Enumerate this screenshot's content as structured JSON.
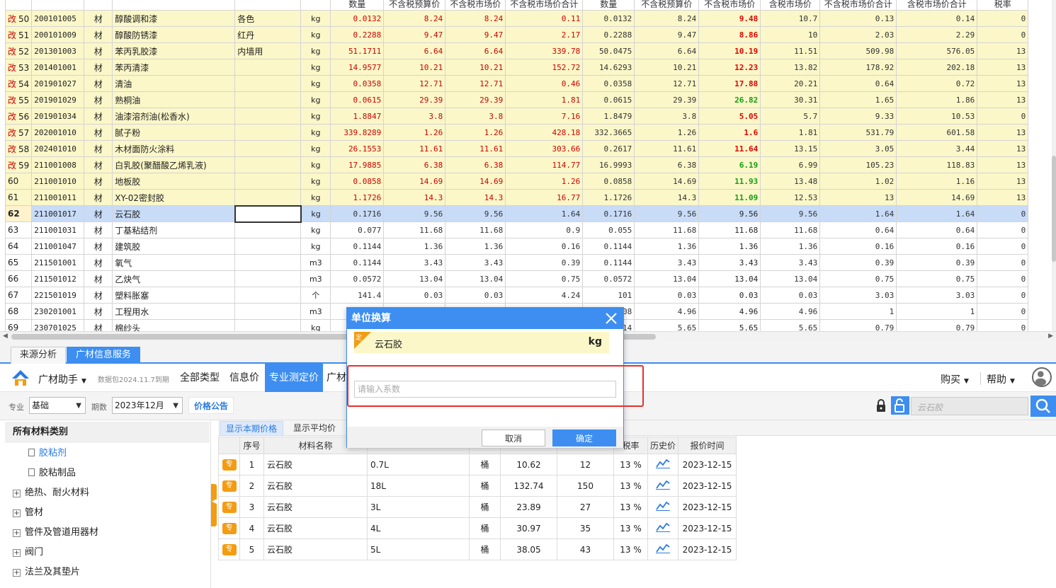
{
  "grid": {
    "headers": [
      "",
      "",
      "",
      "",
      "",
      "",
      "数量",
      "不含税预算价",
      "不含税市场价",
      "不含税市场价合计",
      "数量",
      "不含税预算价",
      "不含税市场价",
      "含税市场价",
      "不含税市场价合计",
      "含税市场价合计",
      "税率"
    ],
    "rows": [
      {
        "mark": "改",
        "no": "50",
        "code": "200101005",
        "type": "材",
        "name": "醇酸调和漆",
        "spec": "各色",
        "unit": "kg",
        "qty1": "0.0132",
        "bp": "8.24",
        "mp": "8.24",
        "mpt": "0.11",
        "qty2": "0.0132",
        "bp2": "8.24",
        "mp2": "9.48",
        "tp": "10.7",
        "mpt2": "0.13",
        "tpt": "0.14",
        "tax": "0",
        "style": "mod",
        "mp2c": "red"
      },
      {
        "mark": "改",
        "no": "51",
        "code": "200101009",
        "type": "材",
        "name": "醇酸防锈漆",
        "spec": "红丹",
        "unit": "kg",
        "qty1": "0.2288",
        "bp": "9.47",
        "mp": "9.47",
        "mpt": "2.17",
        "qty2": "0.2288",
        "bp2": "9.47",
        "mp2": "8.86",
        "tp": "10",
        "mpt2": "2.03",
        "tpt": "2.29",
        "tax": "0",
        "style": "mod",
        "mp2c": "red"
      },
      {
        "mark": "改",
        "no": "52",
        "code": "201301003",
        "type": "材",
        "name": "苯丙乳胶漆",
        "spec": "内墙用",
        "unit": "kg",
        "qty1": "51.1711",
        "bp": "6.64",
        "mp": "6.64",
        "mpt": "339.78",
        "qty2": "50.0475",
        "bp2": "6.64",
        "mp2": "10.19",
        "tp": "11.51",
        "mpt2": "509.98",
        "tpt": "576.05",
        "tax": "13",
        "style": "mod",
        "mp2c": "red"
      },
      {
        "mark": "改",
        "no": "53",
        "code": "201401001",
        "type": "材",
        "name": "苯丙清漆",
        "spec": "",
        "unit": "kg",
        "qty1": "14.9577",
        "bp": "10.21",
        "mp": "10.21",
        "mpt": "152.72",
        "qty2": "14.6293",
        "bp2": "10.21",
        "mp2": "12.23",
        "tp": "13.82",
        "mpt2": "178.92",
        "tpt": "202.18",
        "tax": "13",
        "style": "mod",
        "mp2c": "red"
      },
      {
        "mark": "改",
        "no": "54",
        "code": "201901027",
        "type": "材",
        "name": "清油",
        "spec": "",
        "unit": "kg",
        "qty1": "0.0358",
        "bp": "12.71",
        "mp": "12.71",
        "mpt": "0.46",
        "qty2": "0.0358",
        "bp2": "12.71",
        "mp2": "17.88",
        "tp": "20.21",
        "mpt2": "0.64",
        "tpt": "0.72",
        "tax": "13",
        "style": "mod",
        "mp2c": "red"
      },
      {
        "mark": "改",
        "no": "55",
        "code": "201901029",
        "type": "材",
        "name": "熟桐油",
        "spec": "",
        "unit": "kg",
        "qty1": "0.0615",
        "bp": "29.39",
        "mp": "29.39",
        "mpt": "1.81",
        "qty2": "0.0615",
        "bp2": "29.39",
        "mp2": "26.82",
        "tp": "30.31",
        "mpt2": "1.65",
        "tpt": "1.86",
        "tax": "13",
        "style": "mod",
        "mp2c": "green"
      },
      {
        "mark": "改",
        "no": "56",
        "code": "201901034",
        "type": "材",
        "name": "油漆溶剂油(松香水)",
        "spec": "",
        "unit": "kg",
        "qty1": "1.8847",
        "bp": "3.8",
        "mp": "3.8",
        "mpt": "7.16",
        "qty2": "1.8479",
        "bp2": "3.8",
        "mp2": "5.05",
        "tp": "5.7",
        "mpt2": "9.33",
        "tpt": "10.53",
        "tax": "0",
        "style": "mod",
        "mp2c": "red"
      },
      {
        "mark": "改",
        "no": "57",
        "code": "202001010",
        "type": "材",
        "name": "腻子粉",
        "spec": "",
        "unit": "kg",
        "qty1": "339.8289",
        "bp": "1.26",
        "mp": "1.26",
        "mpt": "428.18",
        "qty2": "332.3665",
        "bp2": "1.26",
        "mp2": "1.6",
        "tp": "1.81",
        "mpt2": "531.79",
        "tpt": "601.58",
        "tax": "13",
        "style": "mod",
        "mp2c": "red"
      },
      {
        "mark": "改",
        "no": "58",
        "code": "202401010",
        "type": "材",
        "name": "木材面防火涂料",
        "spec": "",
        "unit": "kg",
        "qty1": "26.1553",
        "bp": "11.61",
        "mp": "11.61",
        "mpt": "303.66",
        "qty2": "0.2617",
        "bp2": "11.61",
        "mp2": "11.64",
        "tp": "13.15",
        "mpt2": "3.05",
        "tpt": "3.44",
        "tax": "13",
        "style": "mod",
        "mp2c": "red"
      },
      {
        "mark": "改",
        "no": "59",
        "code": "211001008",
        "type": "材",
        "name": "白乳胶(聚醋酸乙烯乳液)",
        "spec": "",
        "unit": "kg",
        "qty1": "17.9885",
        "bp": "6.38",
        "mp": "6.38",
        "mpt": "114.77",
        "qty2": "16.9993",
        "bp2": "6.38",
        "mp2": "6.19",
        "tp": "6.99",
        "mpt2": "105.23",
        "tpt": "118.83",
        "tax": "13",
        "style": "mod",
        "mp2c": "green"
      },
      {
        "mark": "",
        "no": "60",
        "code": "211001010",
        "type": "材",
        "name": "地板胶",
        "spec": "",
        "unit": "kg",
        "qty1": "0.0858",
        "bp": "14.69",
        "mp": "14.69",
        "mpt": "1.26",
        "qty2": "0.0858",
        "bp2": "14.69",
        "mp2": "11.93",
        "tp": "13.48",
        "mpt2": "1.02",
        "tpt": "1.16",
        "tax": "13",
        "style": "mod",
        "mp2c": "green"
      },
      {
        "mark": "",
        "no": "61",
        "code": "211001011",
        "type": "材",
        "name": "XY-02密封胶",
        "spec": "",
        "unit": "kg",
        "qty1": "1.1726",
        "bp": "14.3",
        "mp": "14.3",
        "mpt": "16.77",
        "qty2": "1.1726",
        "bp2": "14.3",
        "mp2": "11.09",
        "tp": "12.53",
        "mpt2": "13",
        "tpt": "14.69",
        "tax": "13",
        "style": "mod",
        "mp2c": "green"
      },
      {
        "mark": "",
        "no": "62",
        "code": "211001017",
        "type": "材",
        "name": "云石胶",
        "spec": "",
        "unit": "kg",
        "qty1": "0.1716",
        "bp": "9.56",
        "mp": "9.56",
        "mpt": "1.64",
        "qty2": "0.1716",
        "bp2": "9.56",
        "mp2": "9.56",
        "tp": "9.56",
        "mpt2": "1.64",
        "tpt": "1.64",
        "tax": "0",
        "style": "sel",
        "mp2c": "plain"
      },
      {
        "mark": "",
        "no": "63",
        "code": "211001031",
        "type": "材",
        "name": "丁基粘结剂",
        "spec": "",
        "unit": "kg",
        "qty1": "0.077",
        "bp": "11.68",
        "mp": "11.68",
        "mpt": "0.9",
        "qty2": "0.055",
        "bp2": "11.68",
        "mp2": "11.68",
        "tp": "11.68",
        "mpt2": "0.64",
        "tpt": "0.64",
        "tax": "0",
        "style": "normal",
        "mp2c": "plain"
      },
      {
        "mark": "",
        "no": "64",
        "code": "211001047",
        "type": "材",
        "name": "建筑胶",
        "spec": "",
        "unit": "kg",
        "qty1": "0.1144",
        "bp": "1.36",
        "mp": "1.36",
        "mpt": "0.16",
        "qty2": "0.1144",
        "bp2": "1.36",
        "mp2": "1.36",
        "tp": "1.36",
        "mpt2": "0.16",
        "tpt": "0.16",
        "tax": "0",
        "style": "normal",
        "mp2c": "plain"
      },
      {
        "mark": "",
        "no": "65",
        "code": "211501001",
        "type": "材",
        "name": "氧气",
        "spec": "",
        "unit": "m3",
        "qty1": "0.1144",
        "bp": "3.43",
        "mp": "3.43",
        "mpt": "0.39",
        "qty2": "0.1144",
        "bp2": "3.43",
        "mp2": "3.43",
        "tp": "3.43",
        "mpt2": "0.39",
        "tpt": "0.39",
        "tax": "0",
        "style": "normal",
        "mp2c": "plain"
      },
      {
        "mark": "",
        "no": "66",
        "code": "211501012",
        "type": "材",
        "name": "乙炔气",
        "spec": "",
        "unit": "m3",
        "qty1": "0.0572",
        "bp": "13.04",
        "mp": "13.04",
        "mpt": "0.75",
        "qty2": "0.0572",
        "bp2": "13.04",
        "mp2": "13.04",
        "tp": "13.04",
        "mpt2": "0.75",
        "tpt": "0.75",
        "tax": "0",
        "style": "normal",
        "mp2c": "plain"
      },
      {
        "mark": "",
        "no": "67",
        "code": "221501019",
        "type": "材",
        "name": "塑料胀塞",
        "spec": "",
        "unit": "个",
        "qty1": "141.4",
        "bp": "0.03",
        "mp": "0.03",
        "mpt": "4.24",
        "qty2": "101",
        "bp2": "0.03",
        "mp2": "0.03",
        "tp": "0.03",
        "mpt2": "3.03",
        "tpt": "3.03",
        "tax": "0",
        "style": "normal",
        "mp2c": "plain"
      },
      {
        "mark": "",
        "no": "68",
        "code": "230201001",
        "type": "材",
        "name": "工程用水",
        "spec": "",
        "unit": "m3",
        "qty1": "",
        "bp": "",
        "mp": "",
        "mpt": "",
        "qty2": "2008",
        "bp2": "4.96",
        "mp2": "4.96",
        "tp": "4.96",
        "mpt2": "1",
        "tpt": "1",
        "tax": "0",
        "style": "normal",
        "mp2c": "plain"
      },
      {
        "mark": "",
        "no": "69",
        "code": "230701025",
        "type": "材",
        "name": "棉纱头",
        "spec": "",
        "unit": "kg",
        "qty1": "",
        "bp": "",
        "mp": "",
        "mpt": "",
        "qty2": "0.14",
        "bp2": "5.65",
        "mp2": "5.65",
        "tp": "5.65",
        "mpt2": "0.79",
        "tpt": "0.79",
        "tax": "0",
        "style": "normal",
        "mp2c": "plain"
      }
    ]
  },
  "tabs": {
    "source": "来源分析",
    "service": "广材信息服务"
  },
  "toolbar": {
    "brand": "广材助手",
    "data_pack": "数据包2024.11.7到期",
    "nav": [
      "全部类型",
      "信息价",
      "专业测定价",
      "广材"
    ],
    "buy": "购买",
    "help": "帮助"
  },
  "filter": {
    "major_label": "专业",
    "major_value": "基础",
    "period_label": "期数",
    "period_value": "2023年12月",
    "notice": "价格公告",
    "search_placeholder": "云石胶"
  },
  "left_panel": {
    "title": "所有材料类别",
    "items": [
      {
        "label": "胶粘剂",
        "kind": "leaf",
        "active": true
      },
      {
        "label": "胶粘制品",
        "kind": "leaf",
        "active": false
      },
      {
        "label": "绝热、耐火材料",
        "kind": "group"
      },
      {
        "label": "管材",
        "kind": "group"
      },
      {
        "label": "管件及管道用器材",
        "kind": "group"
      },
      {
        "label": "阀门",
        "kind": "group"
      },
      {
        "label": "法兰及其垫片",
        "kind": "group"
      }
    ]
  },
  "right_panel": {
    "tab_current": "显示本期价格",
    "tab_avg": "显示平均价",
    "headers": [
      "序号",
      "材料名称",
      "",
      "",
      "",
      "",
      "税率",
      "历史价",
      "报价时间"
    ],
    "badge": "专",
    "rows": [
      {
        "no": "1",
        "name": "云石胶",
        "spec": "0.7L",
        "unit": "桶",
        "p1": "10.62",
        "p2": "12",
        "tax": "13 %",
        "date": "2023-12-15"
      },
      {
        "no": "2",
        "name": "云石胶",
        "spec": "18L",
        "unit": "桶",
        "p1": "132.74",
        "p2": "150",
        "tax": "13 %",
        "date": "2023-12-15"
      },
      {
        "no": "3",
        "name": "云石胶",
        "spec": "3L",
        "unit": "桶",
        "p1": "23.89",
        "p2": "27",
        "tax": "13 %",
        "date": "2023-12-15"
      },
      {
        "no": "4",
        "name": "云石胶",
        "spec": "4L",
        "unit": "桶",
        "p1": "30.97",
        "p2": "35",
        "tax": "13 %",
        "date": "2023-12-15"
      },
      {
        "no": "5",
        "name": "云石胶",
        "spec": "5L",
        "unit": "桶",
        "p1": "38.05",
        "p2": "43",
        "tax": "13 %",
        "date": "2023-12-15"
      }
    ]
  },
  "dialog": {
    "title": "单位换算",
    "corner": "定",
    "item_name": "云石胶",
    "item_unit": "kg",
    "input_placeholder": "请输入系数",
    "cancel": "取消",
    "ok": "确定"
  },
  "colors": {
    "accent": "#3d8ef0",
    "modified_row": "#fbf7c8",
    "selected_row": "#c8dcf8",
    "highlight_box": "#e53030"
  }
}
